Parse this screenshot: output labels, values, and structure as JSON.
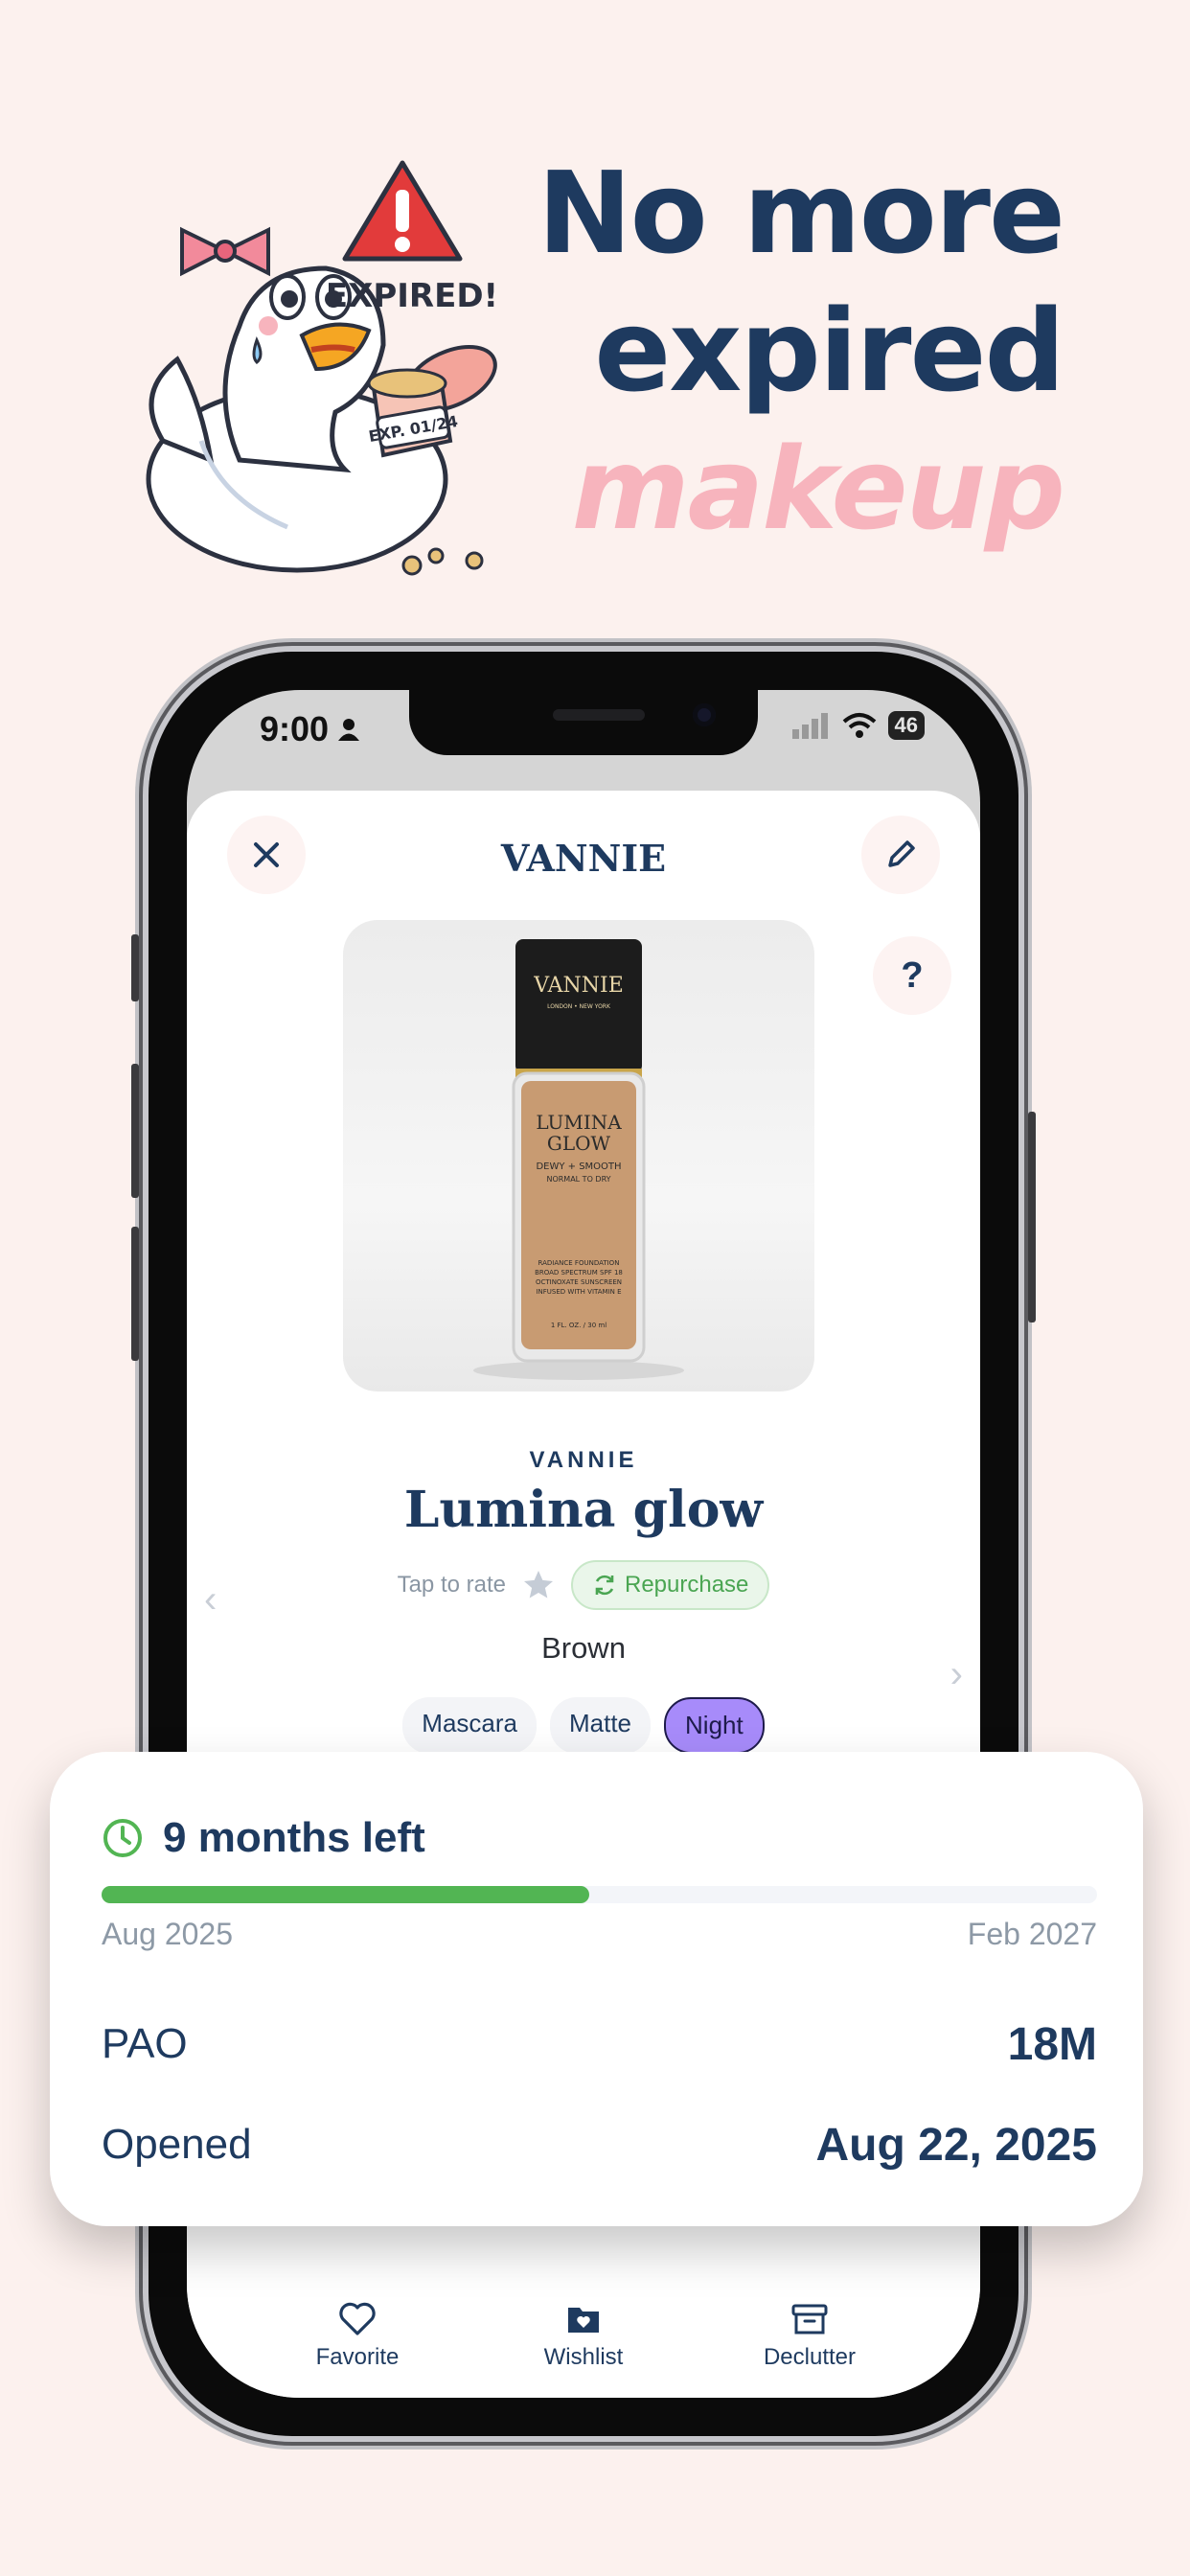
{
  "headline": {
    "line1": "No more",
    "line2": "expired",
    "line3": "makeup"
  },
  "mascot": {
    "warning_text": "EXPIRED!",
    "jar_label": "EXP. 01/24"
  },
  "status_bar": {
    "time": "9:00",
    "battery": "46"
  },
  "header": {
    "brand": "VANNIE"
  },
  "product": {
    "bottle": {
      "brand": "VANNIE",
      "sub": "LONDON • NEW YORK",
      "name1": "LUMINA",
      "name2": "GLOW",
      "desc1": "DEWY + SMOOTH",
      "desc2": "NORMAL TO DRY",
      "small1": "RADIANCE FOUNDATION",
      "small2": "BROAD SPECTRUM SPF 18",
      "small3": "OCTINOXATE SUNSCREEN",
      "small4": "INFUSED WITH VITAMIN E",
      "size": "1 FL. OZ. / 30 ml"
    },
    "brand": "VANNIE",
    "name": "Lumina glow",
    "tap_to_rate": "Tap to rate",
    "repurchase": "Repurchase",
    "shade": "Brown",
    "tags": [
      {
        "label": "Mascara",
        "active": false
      },
      {
        "label": "Matte",
        "active": false
      },
      {
        "label": "Night",
        "active": true
      }
    ]
  },
  "help_button": "?",
  "expiry": {
    "months_left": "9 months left",
    "progress": 0.49,
    "start": "Aug 2025",
    "end": "Feb 2027",
    "pao_label": "PAO",
    "pao_value": "18M",
    "opened_label": "Opened",
    "opened_value": "Aug 22, 2025"
  },
  "bottom_nav": {
    "favorite": "Favorite",
    "wishlist": "Wishlist",
    "declutter": "Declutter"
  },
  "colors": {
    "background": "#fcf1ee",
    "navy": "#1e3a5f",
    "pink": "#f7b4bd",
    "green": "#52b553",
    "purple": "#a78bfa"
  }
}
